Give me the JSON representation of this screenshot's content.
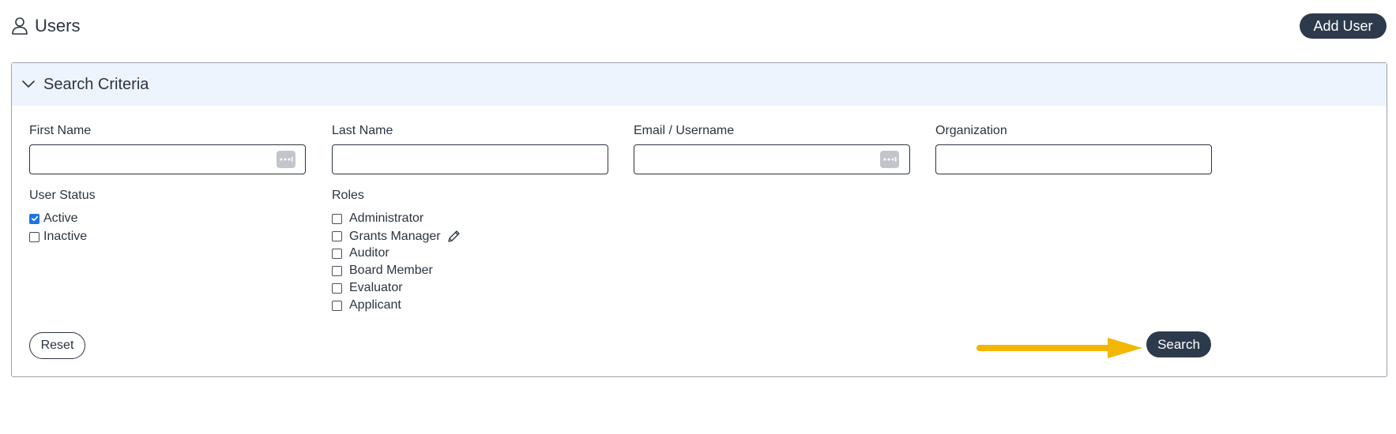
{
  "header": {
    "title": "Users",
    "add_user_label": "Add User"
  },
  "panel": {
    "title": "Search Criteria",
    "fields": {
      "first_name": {
        "label": "First Name",
        "value": ""
      },
      "last_name": {
        "label": "Last Name",
        "value": ""
      },
      "email": {
        "label": "Email / Username",
        "value": ""
      },
      "organization": {
        "label": "Organization",
        "value": ""
      }
    },
    "user_status": {
      "label": "User Status",
      "options": [
        {
          "label": "Active",
          "checked": true
        },
        {
          "label": "Inactive",
          "checked": false
        }
      ]
    },
    "roles": {
      "label": "Roles",
      "options": [
        {
          "label": "Administrator",
          "checked": false
        },
        {
          "label": "Grants Manager",
          "checked": false
        },
        {
          "label": "Auditor",
          "checked": false
        },
        {
          "label": "Board Member",
          "checked": false
        },
        {
          "label": "Evaluator",
          "checked": false
        },
        {
          "label": "Applicant",
          "checked": false
        }
      ]
    },
    "reset_label": "Reset",
    "search_label": "Search"
  },
  "colors": {
    "primary_button": "#2c3a4b",
    "panel_header_bg": "#eef4fd",
    "annotation_arrow": "#f2b705",
    "checkbox_checked": "#1a73e8"
  },
  "icons": {
    "header": "user-icon",
    "panel_toggle": "chevron-down-icon",
    "lookup": "ellipsis-icon",
    "edit": "pencil-icon"
  }
}
